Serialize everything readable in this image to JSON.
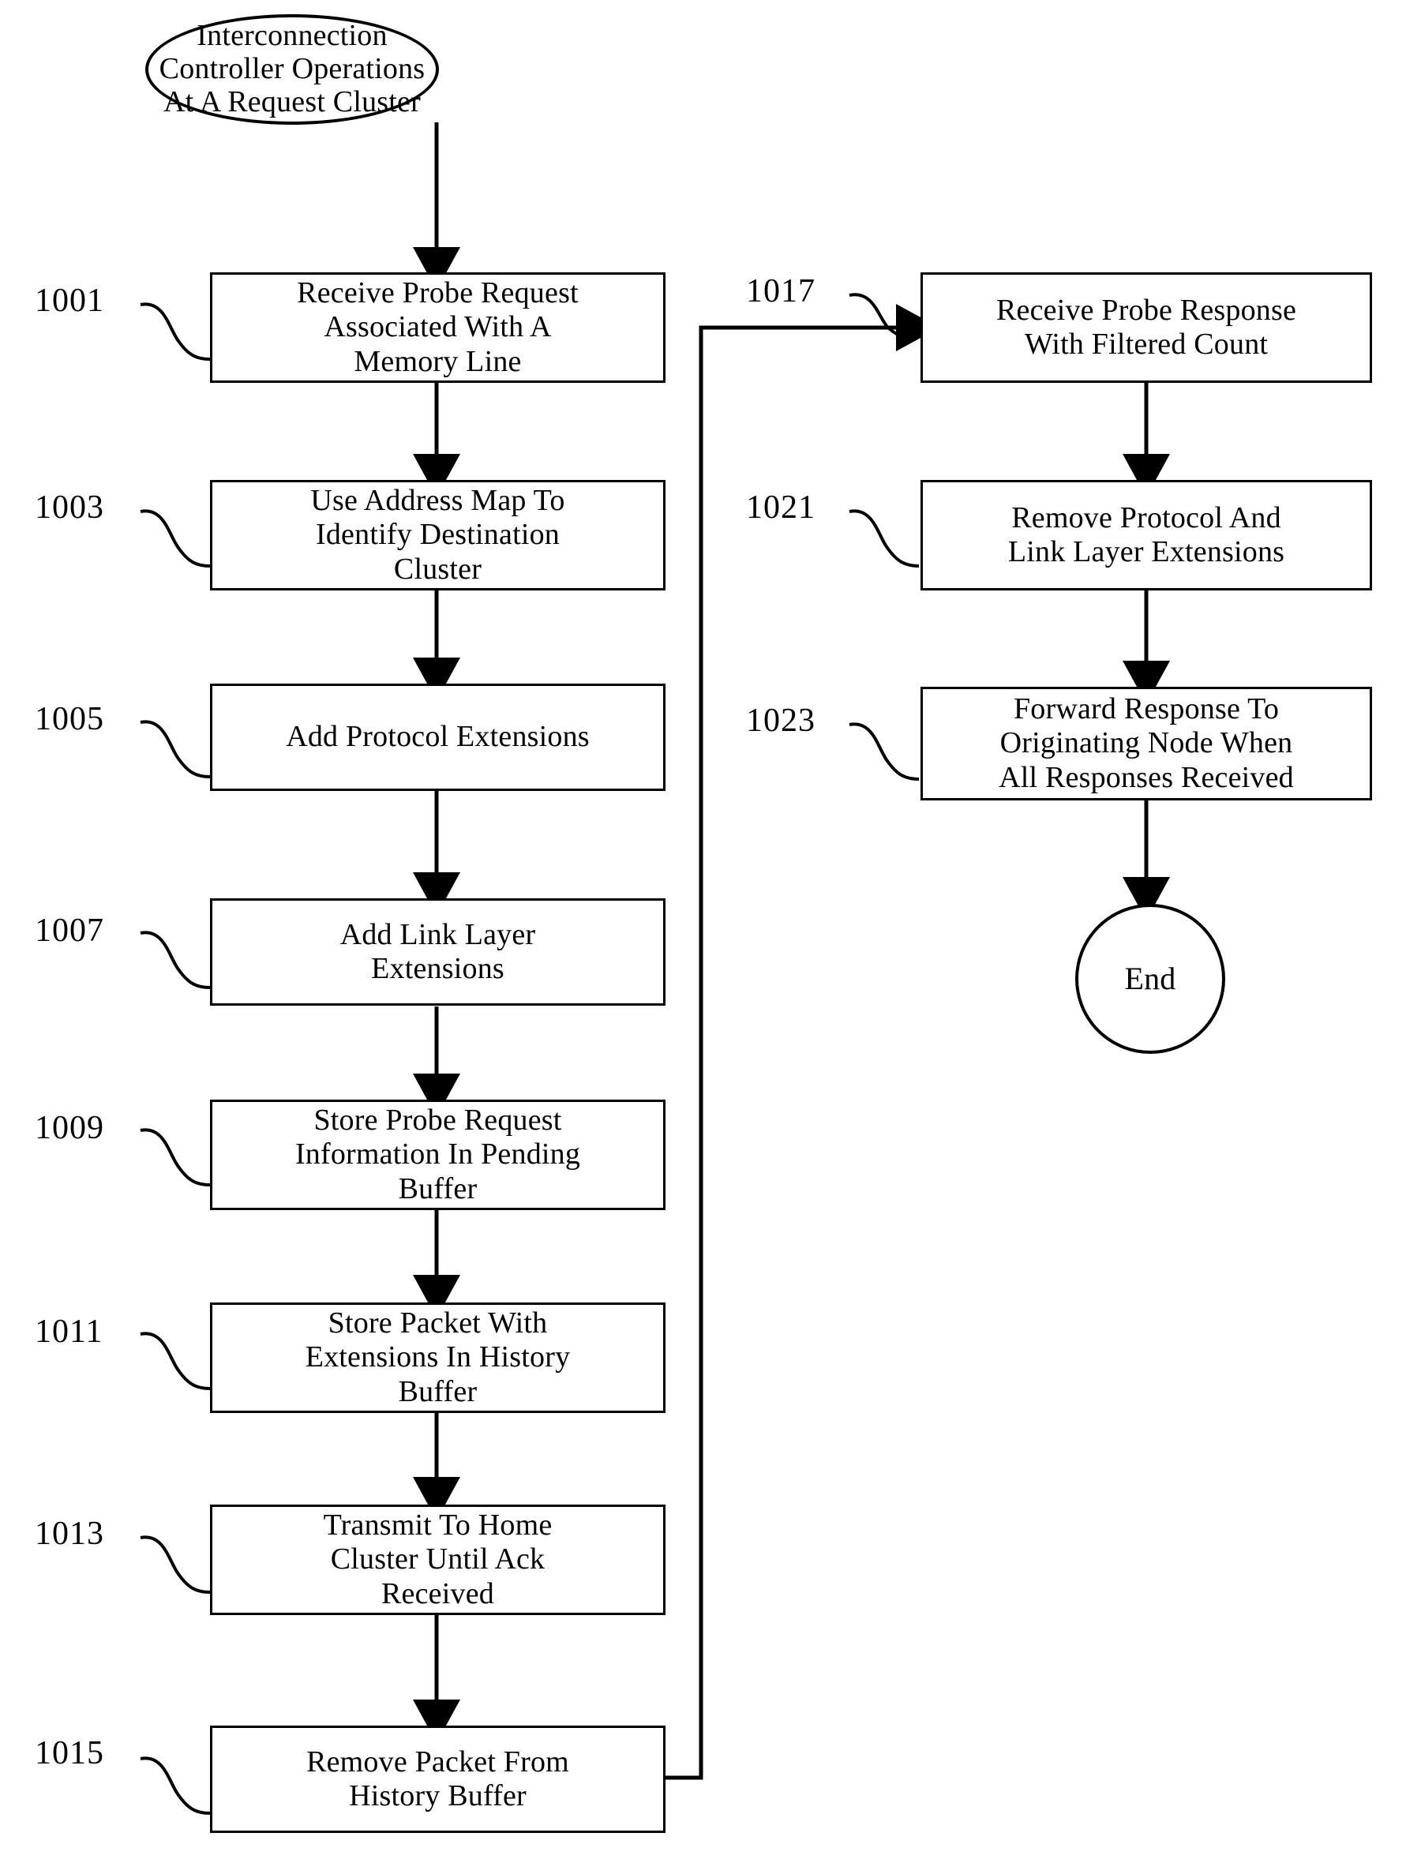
{
  "figure": {
    "type": "flowchart",
    "title_node": {
      "id": "start",
      "shape": "oval",
      "label": "Interconnection\nController Operations\nAt A Request Cluster"
    },
    "end_node": {
      "id": "end",
      "shape": "circle",
      "label": "End"
    },
    "left_column": [
      {
        "ref": "1001",
        "label": "Receive Probe Request\nAssociated With A\nMemory Line"
      },
      {
        "ref": "1003",
        "label": "Use Address Map To\nIdentify Destination\nCluster"
      },
      {
        "ref": "1005",
        "label": "Add Protocol Extensions"
      },
      {
        "ref": "1007",
        "label": "Add Link Layer\nExtensions"
      },
      {
        "ref": "1009",
        "label": "Store Probe Request\nInformation In Pending\nBuffer"
      },
      {
        "ref": "1011",
        "label": "Store Packet With\nExtensions In History\nBuffer"
      },
      {
        "ref": "1013",
        "label": "Transmit To Home\nCluster Until Ack\nReceived"
      },
      {
        "ref": "1015",
        "label": "Remove Packet From\nHistory Buffer"
      }
    ],
    "right_column": [
      {
        "ref": "1017",
        "label": "Receive Probe Response\nWith Filtered Count"
      },
      {
        "ref": "1021",
        "label": "Remove Protocol And\nLink Layer Extensions"
      },
      {
        "ref": "1023",
        "label": "Forward Response To\nOriginating Node When\nAll Responses Received"
      }
    ],
    "colors": {
      "ink": "#000000",
      "paper": "#ffffff"
    }
  }
}
